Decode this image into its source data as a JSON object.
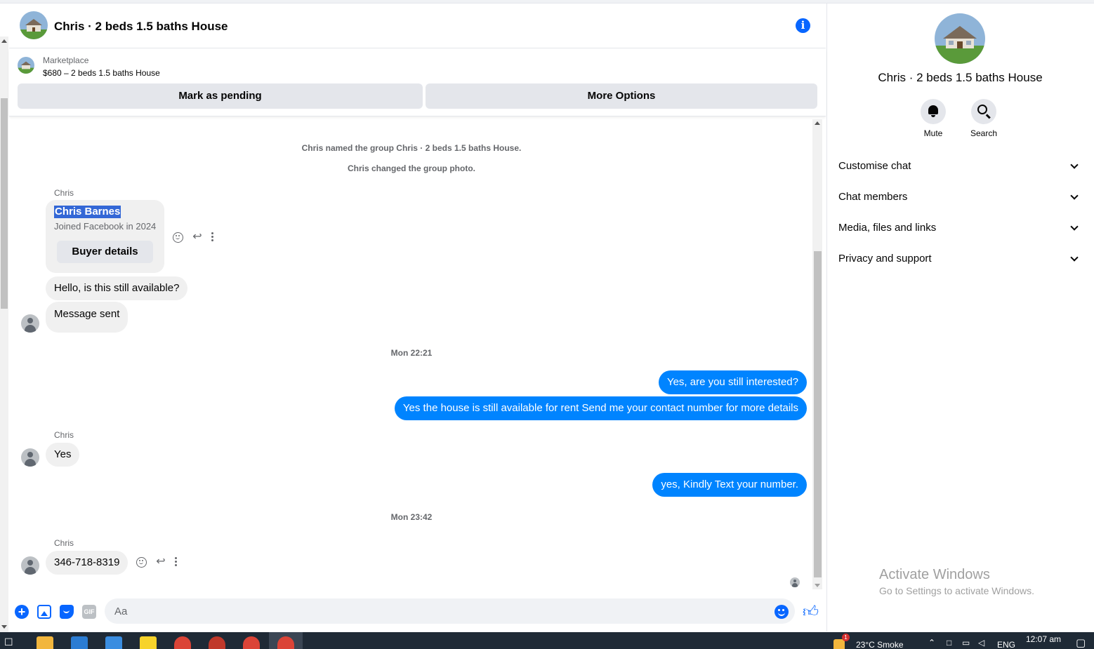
{
  "header": {
    "title": "Chris · 2 beds 1.5 baths House"
  },
  "marketplace": {
    "label": "Marketplace",
    "item": "$680 – 2 beds 1.5 baths House",
    "mark_pending": "Mark as pending",
    "more_options": "More Options"
  },
  "messages": {
    "system1": "Chris named the group Chris · 2 beds 1.5 baths House.",
    "system2": "Chris changed the group photo.",
    "sender_name": "Chris",
    "profile_name": "Chris Barnes",
    "profile_sub": "Joined Facebook in 2024",
    "buyer_details": "Buyer details",
    "in1": "Hello, is this still available?",
    "in2": "Message sent",
    "time1": "Mon 22:21",
    "out1": "Yes, are you still interested?",
    "out2": "Yes the house is still available for rent Send me your contact number for more details",
    "in3": "Yes",
    "out3": "yes, Kindly Text your number.",
    "time2": "Mon 23:42",
    "in4": "346-718-8319"
  },
  "composer": {
    "placeholder": "Aa",
    "gif_label": "GIF"
  },
  "right_panel": {
    "title": "Chris · 2 beds 1.5 baths House",
    "mute": "Mute",
    "search": "Search",
    "sections": [
      "Customise chat",
      "Chat members",
      "Media, files and links",
      "Privacy and support"
    ]
  },
  "watermark": {
    "line1": "Activate Windows",
    "line2": "Go to Settings to activate Windows."
  },
  "taskbar": {
    "weather": "23°C  Smoke",
    "lang": "ENG",
    "time": "12:07 am",
    "notification_count": "1"
  },
  "colors": {
    "accent": "#0866ff",
    "outgoing_bubble": "#0084ff",
    "incoming_bubble": "#f0f0f0"
  }
}
